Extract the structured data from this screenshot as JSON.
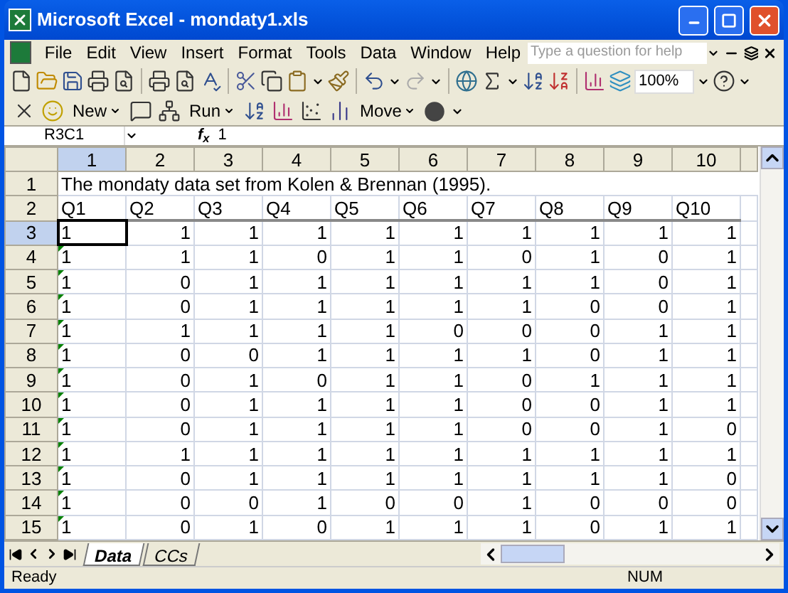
{
  "window": {
    "title": "Microsoft Excel - mondaty1.xls"
  },
  "menu": [
    "File",
    "Edit",
    "View",
    "Insert",
    "Format",
    "Tools",
    "Data",
    "Window",
    "Help"
  ],
  "help_search": {
    "placeholder": "Type a question for help"
  },
  "toolbar": {
    "zoom": "100%"
  },
  "toolbar2": {
    "buttons": [
      "New",
      "Run",
      "Move"
    ]
  },
  "formula_bar": {
    "name_box": "R3C1",
    "fx": "f$_{x}$",
    "value": "1"
  },
  "columns": [
    {
      "label": "1",
      "selected": true
    },
    {
      "label": "2",
      "selected": false
    },
    {
      "label": "3",
      "selected": false
    },
    {
      "label": "4",
      "selected": false
    },
    {
      "label": "5",
      "selected": false
    },
    {
      "label": "6",
      "selected": false
    },
    {
      "label": "7",
      "selected": false
    },
    {
      "label": "8",
      "selected": false
    },
    {
      "label": "9",
      "selected": false
    },
    {
      "label": "10",
      "selected": false
    }
  ],
  "rows": [
    {
      "header": "1",
      "kind": "title",
      "selected": false,
      "cells": [
        "The mondaty data set from Kolen & Brennan (1995)."
      ]
    },
    {
      "header": "2",
      "kind": "labels",
      "selected": false,
      "cells": [
        "Q1",
        "Q2",
        "Q3",
        "Q4",
        "Q5",
        "Q6",
        "Q7",
        "Q8",
        "Q9",
        "Q10"
      ]
    },
    {
      "header": "3",
      "kind": "data",
      "selected": true,
      "flagged": false,
      "cells": [
        "1",
        "1",
        "1",
        "1",
        "1",
        "1",
        "1",
        "1",
        "1",
        "1"
      ]
    },
    {
      "header": "4",
      "kind": "data",
      "selected": false,
      "flagged": true,
      "cells": [
        "1",
        "1",
        "1",
        "0",
        "1",
        "1",
        "0",
        "1",
        "0",
        "1"
      ]
    },
    {
      "header": "5",
      "kind": "data",
      "selected": false,
      "flagged": true,
      "cells": [
        "1",
        "0",
        "1",
        "1",
        "1",
        "1",
        "1",
        "1",
        "0",
        "1"
      ]
    },
    {
      "header": "6",
      "kind": "data",
      "selected": false,
      "flagged": true,
      "cells": [
        "1",
        "0",
        "1",
        "1",
        "1",
        "1",
        "1",
        "0",
        "0",
        "1"
      ]
    },
    {
      "header": "7",
      "kind": "data",
      "selected": false,
      "flagged": true,
      "cells": [
        "1",
        "1",
        "1",
        "1",
        "1",
        "0",
        "0",
        "0",
        "1",
        "1"
      ]
    },
    {
      "header": "8",
      "kind": "data",
      "selected": false,
      "flagged": true,
      "cells": [
        "1",
        "0",
        "0",
        "1",
        "1",
        "1",
        "1",
        "0",
        "1",
        "1"
      ]
    },
    {
      "header": "9",
      "kind": "data",
      "selected": false,
      "flagged": true,
      "cells": [
        "1",
        "0",
        "1",
        "0",
        "1",
        "1",
        "0",
        "1",
        "1",
        "1"
      ]
    },
    {
      "header": "10",
      "kind": "data",
      "selected": false,
      "flagged": true,
      "cells": [
        "1",
        "0",
        "1",
        "1",
        "1",
        "1",
        "0",
        "0",
        "1",
        "1"
      ]
    },
    {
      "header": "11",
      "kind": "data",
      "selected": false,
      "flagged": true,
      "cells": [
        "1",
        "0",
        "1",
        "1",
        "1",
        "1",
        "0",
        "0",
        "1",
        "0"
      ]
    },
    {
      "header": "12",
      "kind": "data",
      "selected": false,
      "flagged": true,
      "cells": [
        "1",
        "1",
        "1",
        "1",
        "1",
        "1",
        "1",
        "1",
        "1",
        "1"
      ]
    },
    {
      "header": "13",
      "kind": "data",
      "selected": false,
      "flagged": true,
      "cells": [
        "1",
        "0",
        "1",
        "1",
        "1",
        "1",
        "1",
        "1",
        "1",
        "0"
      ]
    },
    {
      "header": "14",
      "kind": "data",
      "selected": false,
      "flagged": true,
      "cells": [
        "1",
        "0",
        "0",
        "1",
        "0",
        "0",
        "1",
        "0",
        "0",
        "0"
      ]
    },
    {
      "header": "15",
      "kind": "data",
      "selected": false,
      "flagged": true,
      "cells": [
        "1",
        "0",
        "1",
        "0",
        "1",
        "1",
        "1",
        "0",
        "1",
        "1"
      ]
    }
  ],
  "sheet_tabs": [
    {
      "label": "Data",
      "selected": true
    },
    {
      "label": "CCs",
      "selected": false
    }
  ],
  "status_bar": {
    "mode": "Ready",
    "indicator": "NUM"
  }
}
